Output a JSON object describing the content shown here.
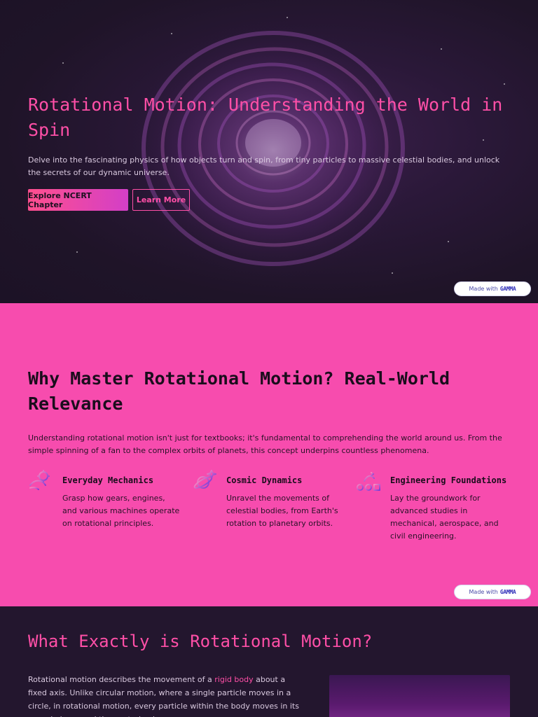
{
  "hero": {
    "title": "Rotational Motion: Understanding the World in Spin",
    "description": "Delve into the fascinating physics of how objects turn and spin, from tiny particles to massive celestial bodies, and unlock the secrets of our dynamic universe.",
    "primary_button": "Explore NCERT Chapter",
    "secondary_button": "Learn More"
  },
  "badge": {
    "prefix": "Made with",
    "brand": "GAMMA"
  },
  "why": {
    "title": "Why Master Rotational Motion? Real-World Relevance",
    "description": "Understanding rotational motion isn't just for textbooks; it's fundamental to comprehending the world around us. From the simple spinning of a fan to the complex orbits of planets, this concept underpins countless phenomena.",
    "features": [
      {
        "icon": "hand-gear-icon",
        "title": "Everyday Mechanics",
        "description": "Grasp how gears, engines, and various machines operate on rotational principles."
      },
      {
        "icon": "planet-icon",
        "title": "Cosmic Dynamics",
        "description": "Unravel the movements of celestial bodies, from Earth's rotation to planetary orbits."
      },
      {
        "icon": "engineering-icon",
        "title": "Engineering Foundations",
        "description": "Lay the groundwork for advanced studies in mechanical, aerospace, and civil engineering."
      }
    ]
  },
  "what": {
    "title": "What Exactly is Rotational Motion?",
    "desc_before": "Rotational motion describes the movement of a ",
    "desc_link": "rigid body",
    "desc_after": " about a fixed axis. Unlike circular motion, where a single particle moves in a circle, in rotational motion, every particle within the body moves in its own circle around the central axis."
  },
  "colors": {
    "accent": "#ff4fa7",
    "dark_bg": "#23162e",
    "pink_bg": "#f74cae"
  }
}
